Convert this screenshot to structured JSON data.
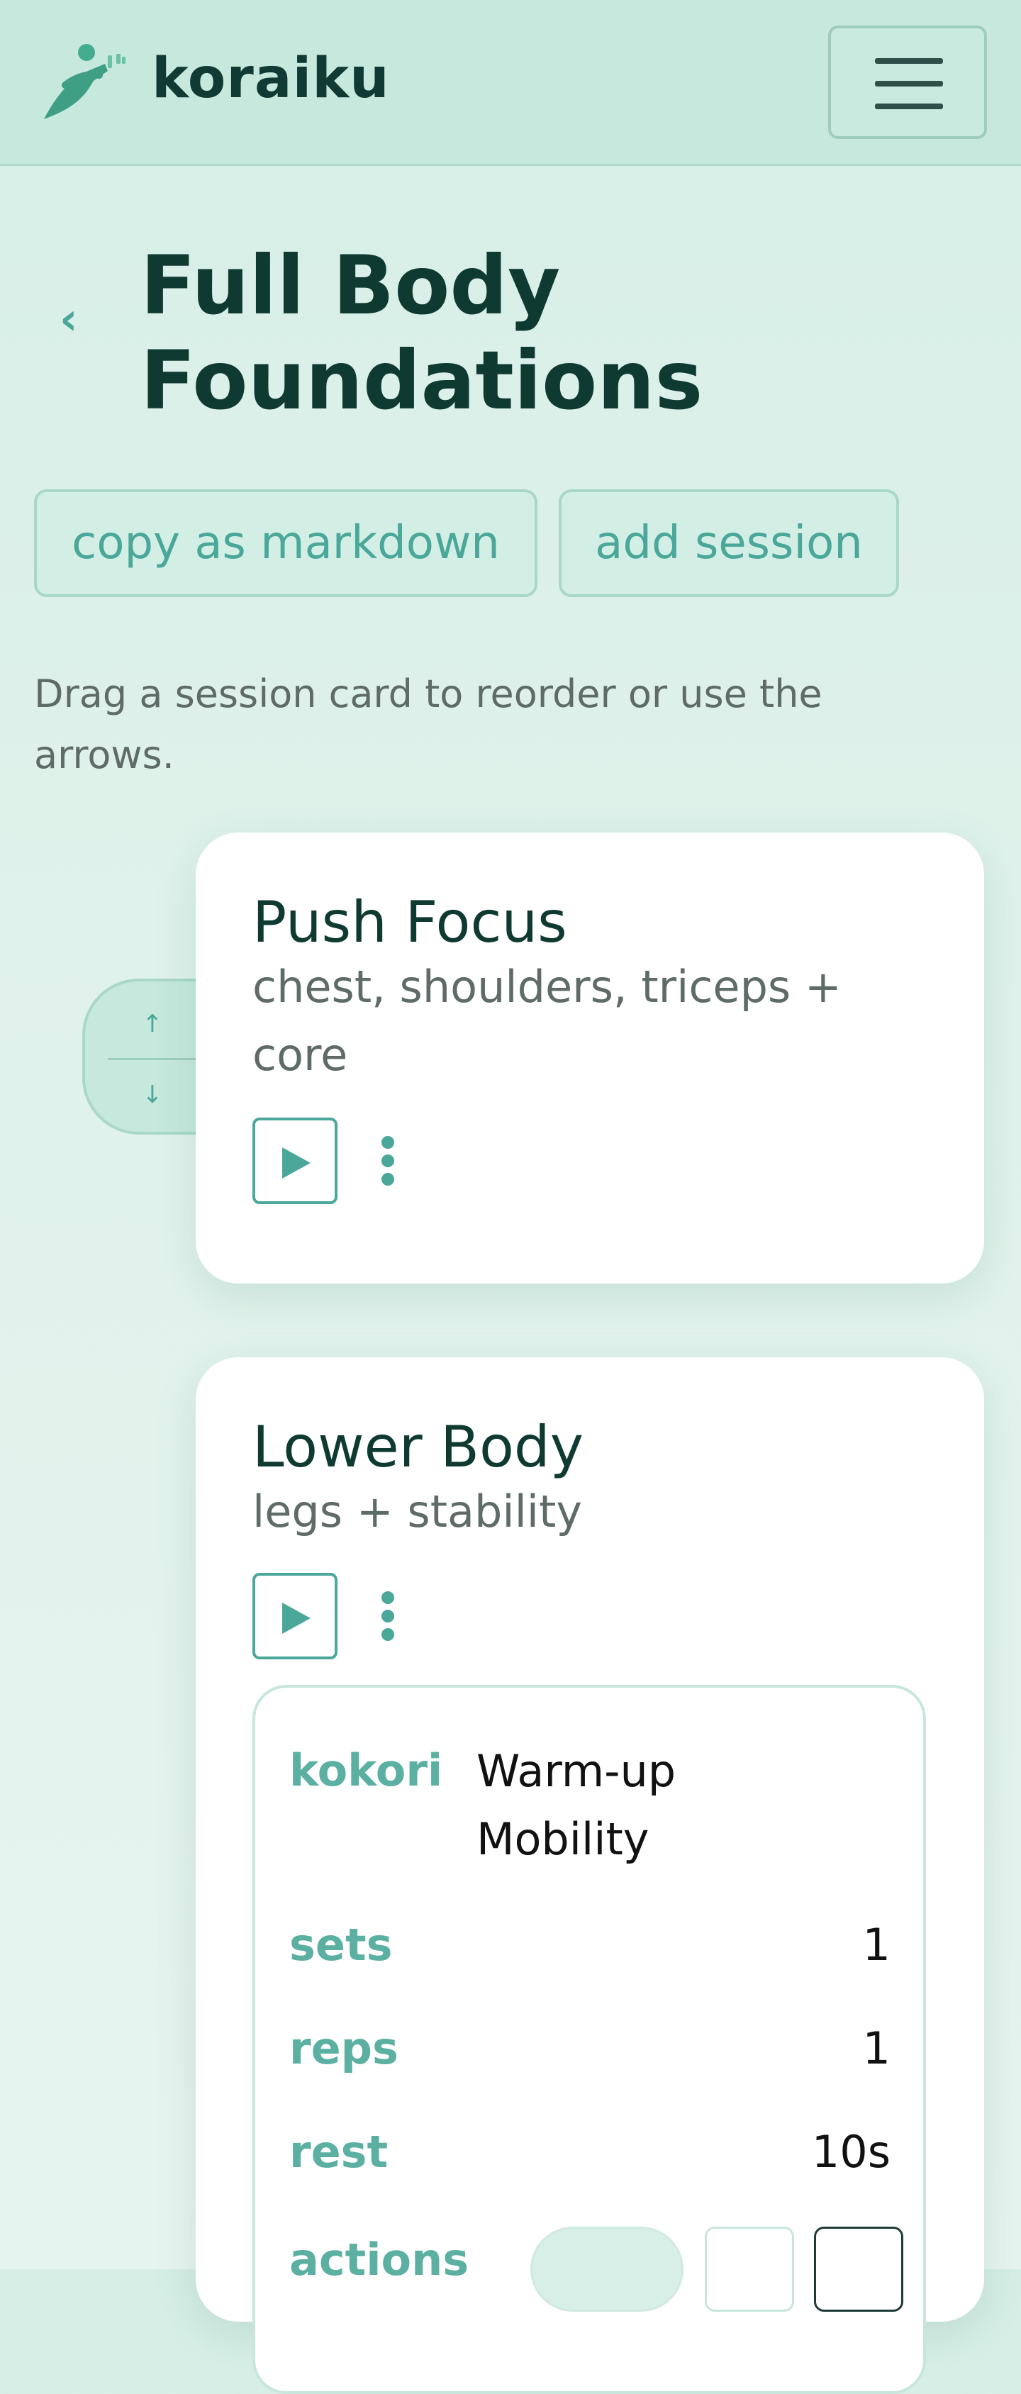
{
  "header": {
    "brand": "koraiku",
    "logo_icon": "runner-logo-icon",
    "menu_icon": "hamburger-menu-icon"
  },
  "page": {
    "back_icon": "chevron-left-icon",
    "back_label": "‹",
    "title": "Full Body Foundations"
  },
  "actions": {
    "copy_markdown": "copy as markdown",
    "add_session": "add session"
  },
  "help_text": "Drag a session card to reorder or use the arrows.",
  "reorder_handle": {
    "up_label": "↑",
    "down_label": "↓"
  },
  "sessions": [
    {
      "title": "Push Focus",
      "subtitle": "chest, shoulders, triceps + core",
      "play_icon": "play-icon",
      "more_icon": "more-vertical-icon"
    },
    {
      "title": "Lower Body",
      "subtitle": "legs + stability",
      "play_icon": "play-icon",
      "more_icon": "more-vertical-icon",
      "exercise": {
        "name_label": "kokori",
        "name_value": "Warm-up Mobility",
        "sets_label": "sets",
        "sets_value": "1",
        "reps_label": "reps",
        "reps_value": "1",
        "rest_label": "rest",
        "rest_value": "10s",
        "actions_label": "actions",
        "edit_icon": "pencil-icon",
        "delete_icon": "trash-icon"
      }
    }
  ],
  "colors": {
    "accent": "#4aa799",
    "header_bg": "#c6e8dd",
    "page_bg": "#dff2eb",
    "title": "#0f3a32"
  }
}
